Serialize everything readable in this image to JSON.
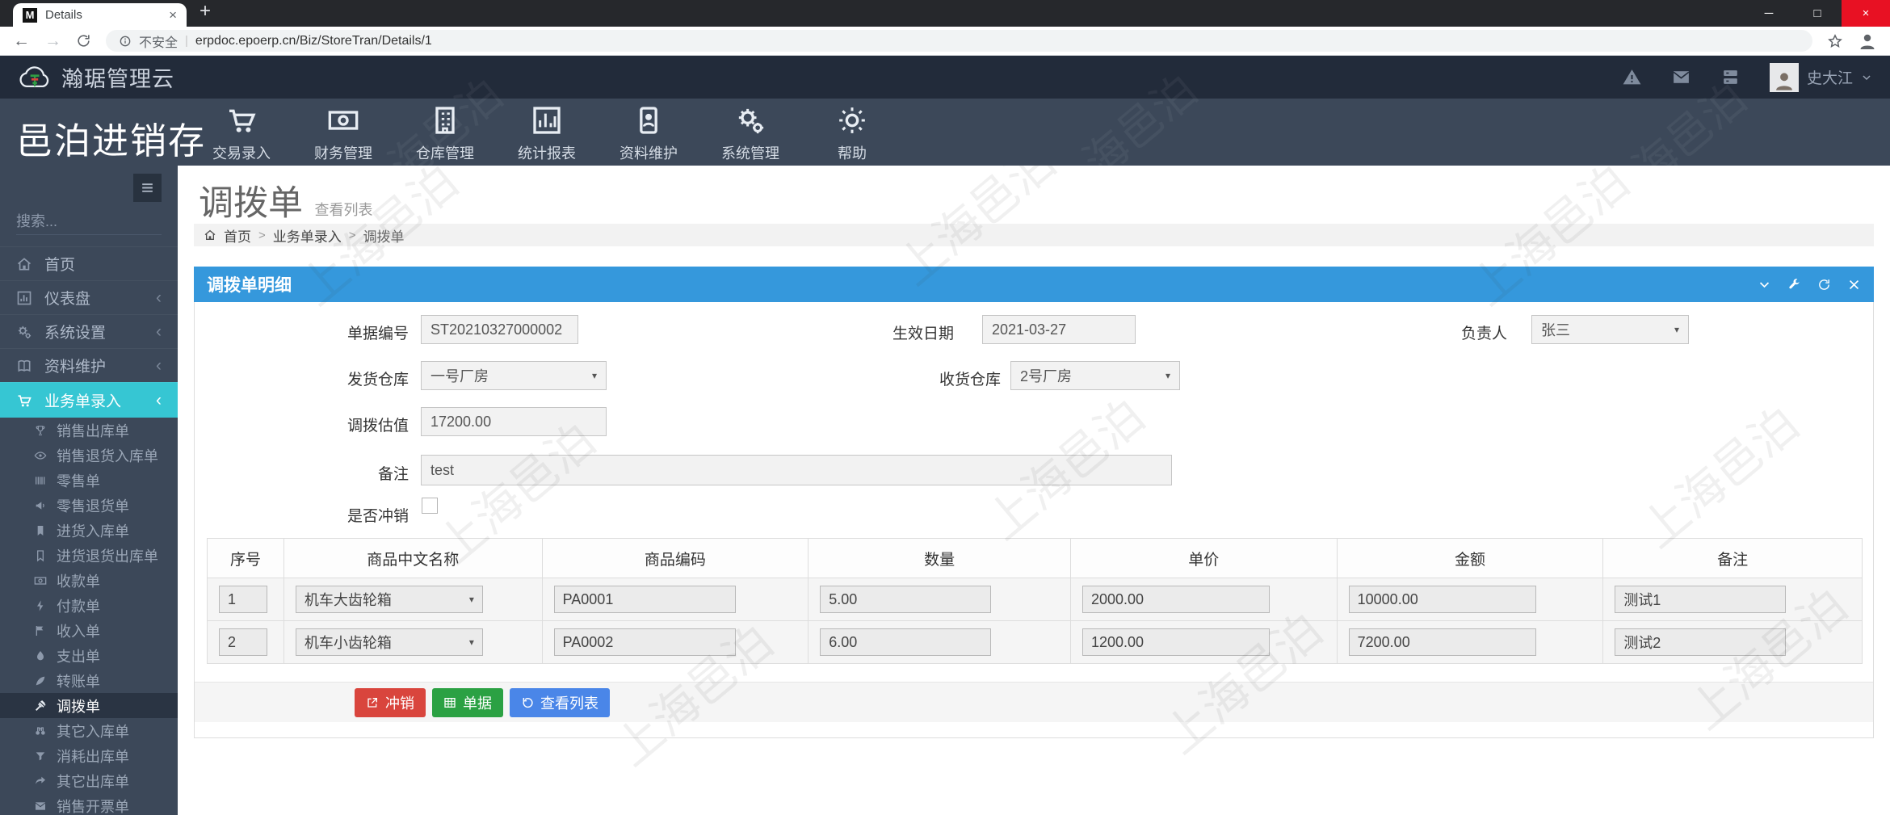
{
  "browser": {
    "tab_title": "Details",
    "favicon": "M",
    "security_label": "不安全",
    "url": "erpdoc.epoerp.cn/Biz/StoreTran/Details/1"
  },
  "icons": {
    "caret": "▾",
    "chevron": "‹",
    "separator": ">",
    "minimize": "─",
    "maximize": "□",
    "close": "×",
    "back": "←",
    "forward": "→",
    "tab_close": "×",
    "new_tab": "+"
  },
  "topbar": {
    "brand": "瀚琚管理云",
    "username": "史大江"
  },
  "appnav": {
    "brand": "邑泊进销存",
    "items": [
      {
        "label": "交易录入"
      },
      {
        "label": "财务管理"
      },
      {
        "label": "仓库管理"
      },
      {
        "label": "统计报表"
      },
      {
        "label": "资料维护"
      },
      {
        "label": "系统管理"
      },
      {
        "label": "帮助"
      }
    ]
  },
  "sidebar": {
    "search_placeholder": "搜索...",
    "items": [
      {
        "label": "首页"
      },
      {
        "label": "仪表盘"
      },
      {
        "label": "系统设置"
      },
      {
        "label": "资料维护"
      },
      {
        "label": "业务单录入"
      }
    ],
    "submenu": [
      "销售出库单",
      "销售退货入库单",
      "零售单",
      "零售退货单",
      "进货入库单",
      "进货退货出库单",
      "收款单",
      "付款单",
      "收入单",
      "支出单",
      "转账单",
      "调拨单",
      "其它入库单",
      "消耗出库单",
      "其它出库单",
      "销售开票单"
    ]
  },
  "page": {
    "title": "调拨单",
    "subtitle": "查看列表",
    "breadcrumb": [
      "首页",
      "业务单录入",
      "调拨单"
    ]
  },
  "panel": {
    "title": "调拨单明细"
  },
  "form": {
    "doc_no": {
      "label": "单据编号",
      "value": "ST20210327000002"
    },
    "effective_date": {
      "label": "生效日期",
      "value": "2021-03-27"
    },
    "owner": {
      "label": "负责人",
      "value": "张三"
    },
    "from_wh": {
      "label": "发货仓库",
      "value": "一号厂房"
    },
    "to_wh": {
      "label": "收货仓库",
      "value": "2号厂房"
    },
    "valuation": {
      "label": "调拨估值",
      "value": "17200.00"
    },
    "remark": {
      "label": "备注",
      "value": "test"
    },
    "reversed": {
      "label": "是否冲销",
      "checked": false
    }
  },
  "table": {
    "headers": [
      "序号",
      "商品中文名称",
      "商品编码",
      "数量",
      "单价",
      "金额",
      "备注"
    ],
    "rows": [
      {
        "seq": "1",
        "name": "机车大齿轮箱",
        "code": "PA0001",
        "qty": "5.00",
        "price": "2000.00",
        "amount": "10000.00",
        "remark": "测试1"
      },
      {
        "seq": "2",
        "name": "机车小齿轮箱",
        "code": "PA0002",
        "qty": "6.00",
        "price": "1200.00",
        "amount": "7200.00",
        "remark": "测试2"
      }
    ]
  },
  "actions": [
    {
      "label": "冲销",
      "color": "#d9453d"
    },
    {
      "label": "单据",
      "color": "#2ba143"
    },
    {
      "label": "查看列表",
      "color": "#4a86e8"
    }
  ],
  "accent": {
    "active_menu": "#36c6d3",
    "panel_header": "#3598dc",
    "topbar": "#222b3a",
    "sidebar": "#3c4859"
  },
  "watermark": "上海邑泊"
}
